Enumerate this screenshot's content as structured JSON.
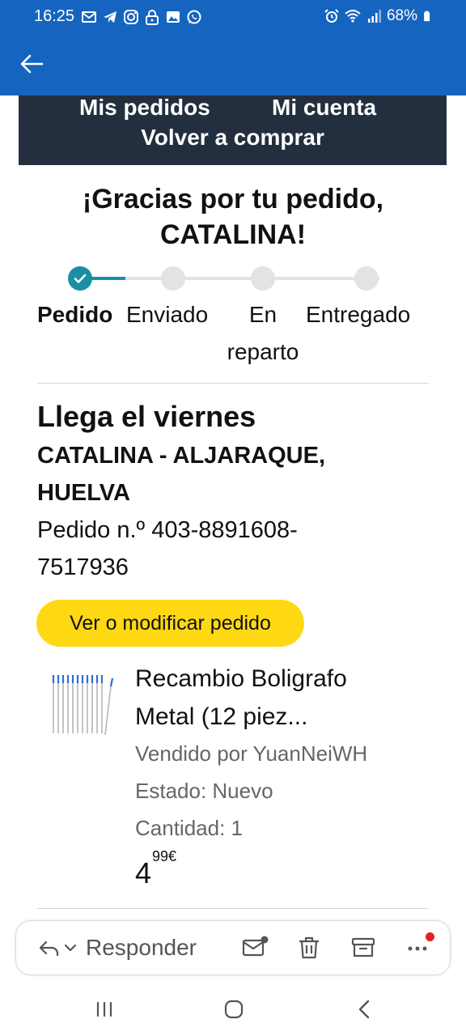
{
  "status_bar": {
    "time": "16:25",
    "battery": "68%",
    "left_icons": [
      "mail-icon",
      "telegram-icon",
      "instagram-icon",
      "lock-icon",
      "image-icon",
      "whatsapp-icon"
    ],
    "right_icons": [
      "alarm-icon",
      "wifi-icon",
      "signal-icon",
      "battery-icon"
    ]
  },
  "app_bar": {
    "back_icon": "arrow-left-icon",
    "color": "#1565c0"
  },
  "email": {
    "nav": {
      "orders": "Mis pedidos",
      "account": "Mi cuenta",
      "rebuy": "Volver a comprar",
      "background": "#232f3e"
    },
    "thanks_line1": "¡Gracias por tu pedido,",
    "thanks_line2": "CATALINA!",
    "progress": {
      "current_step": 1,
      "accent": "#1a8fa3",
      "steps": [
        {
          "label": "Pedido"
        },
        {
          "label": "Enviado"
        },
        {
          "label": "En reparto"
        },
        {
          "label": "Entregado"
        }
      ]
    },
    "arrival": "Llega el viernes",
    "address": "CATALINA - ALJARAQUE, HUELVA",
    "order_number": "Pedido n.º 403-8891608-7517936",
    "modify_button": "Ver o modificar pedido",
    "product": {
      "title": "Recambio Boligrafo Metal (12 piez...",
      "seller": "Vendido por YuanNeiWH",
      "condition": "Estado: Nuevo",
      "quantity": "Cantidad: 1",
      "price_whole": "4",
      "price_fraction": "99€"
    }
  },
  "action_bar": {
    "reply_label": "Responder",
    "icons": [
      "reply-icon",
      "chevron-down-icon",
      "mark-unread-icon",
      "trash-icon",
      "archive-icon",
      "more-icon"
    ]
  },
  "system_nav": {
    "icons": [
      "recents-icon",
      "home-icon",
      "back-icon"
    ]
  }
}
